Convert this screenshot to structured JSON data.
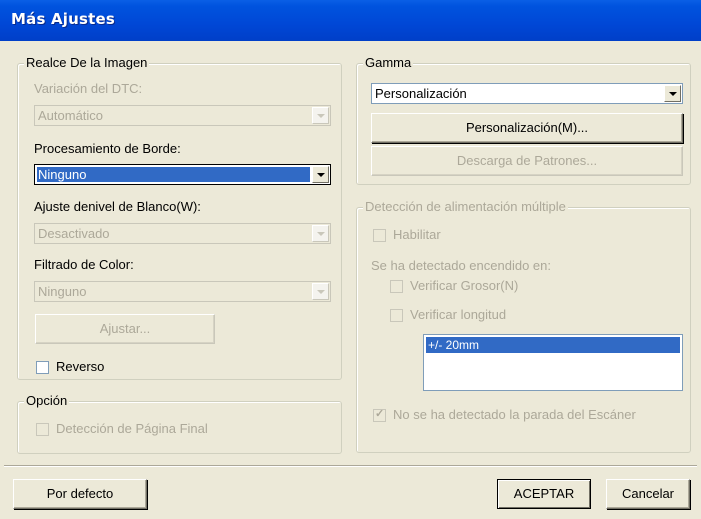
{
  "window": {
    "title": "Más Ajustes"
  },
  "image_enhancement": {
    "legend": "Realce De la Imagen",
    "dtc_variation_label": "Variación del DTC:",
    "dtc_variation_value": "Automático",
    "edge_processing_label": "Procesamiento de Borde:",
    "edge_processing_value": "Ninguno",
    "white_level_label": "Ajuste denivel de Blanco(W):",
    "white_level_value": "Desactivado",
    "color_filter_label": "Filtrado de Color:",
    "color_filter_value": "Ninguno",
    "adjust_button": "Ajustar...",
    "reverse_label": "Reverso"
  },
  "option": {
    "legend": "Opción",
    "end_page_detection_label": "Detección de Página Final"
  },
  "gamma": {
    "legend": "Gamma",
    "value": "Personalización",
    "custom_button": "Personalización(M)...",
    "download_button": "Descarga de Patrones..."
  },
  "multifeed": {
    "legend": "Detección de alimentación múltiple",
    "enable_label": "Habilitar",
    "detected_on_label": "Se ha detectado encendido en:",
    "check_thickness_label": "Verificar Grosor(N)",
    "check_length_label": "Verificar longitud",
    "list_items": [
      "+/- 20mm"
    ],
    "stop_label": "No se ha detectado la parada del Escáner"
  },
  "footer": {
    "default_button": "Por defecto",
    "ok_button": "ACEPTAR",
    "cancel_button": "Cancelar"
  }
}
